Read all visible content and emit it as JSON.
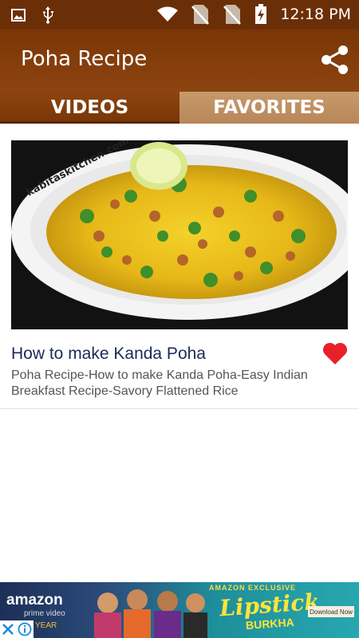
{
  "status_bar": {
    "time": "12:18 PM",
    "icons": [
      "image-icon",
      "usb-icon",
      "wifi-icon",
      "no-sim-icon",
      "no-sim-icon",
      "battery-charging-icon"
    ]
  },
  "app_bar": {
    "title": "Poha Recipe",
    "share_icon": "share-icon"
  },
  "tabs": [
    {
      "label": "VIDEOS",
      "selected": true
    },
    {
      "label": "FAVORITES",
      "selected": false
    }
  ],
  "videos": [
    {
      "thumbnail_watermark": "kabitaskitchen.com",
      "title": "How to make Kanda Poha",
      "description": "Poha Recipe-How to make Kanda Poha-Easy Indian Breakfast Recipe-Savory Flattened Rice",
      "favorite": true
    }
  ],
  "ad": {
    "brand": "amazon",
    "brand_sub": "prime video",
    "year": "YEAR",
    "exclusive": "AMAZON EXCLUSIVE",
    "headline": "Lipstick",
    "headline2": "BURKHA",
    "cta": "Download Now",
    "close_icon": "close-icon",
    "info_icon": "info-icon"
  },
  "colors": {
    "app_bar": "#7b3606",
    "status_bar": "#6b2f08",
    "tab_active": "#8c4410",
    "tab_inactive": "#c79a6a",
    "title_text": "#1b2a5a",
    "heart": "#e8202a"
  }
}
